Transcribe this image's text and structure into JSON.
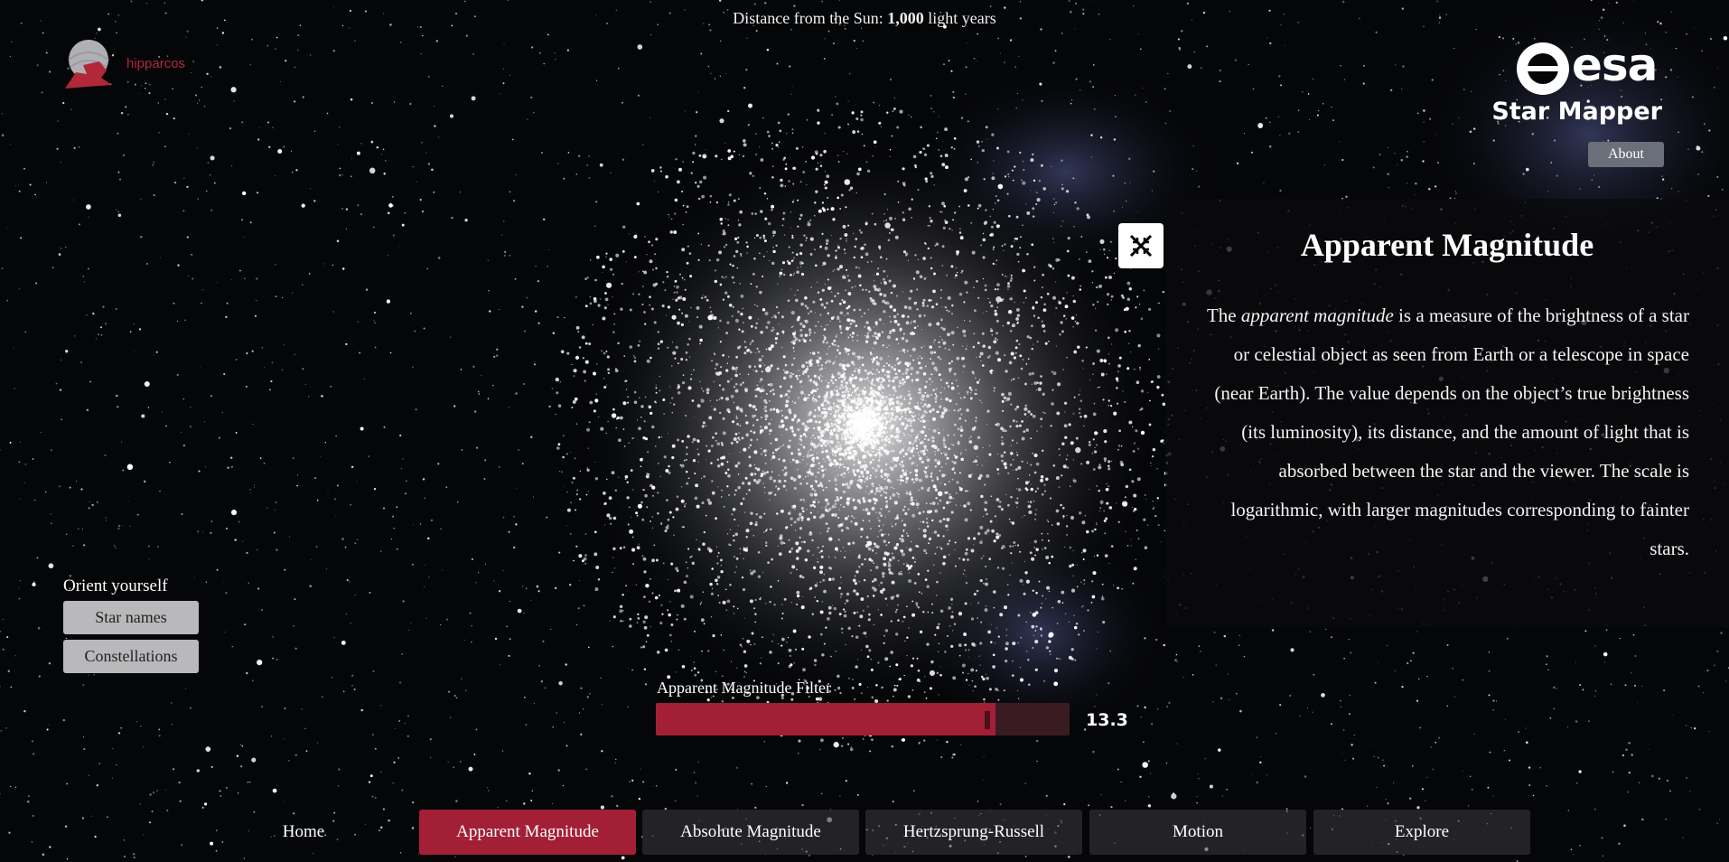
{
  "header": {
    "distance_label": "Distance from the Sun:",
    "distance_value": "1,000",
    "distance_unit": "light years"
  },
  "logos": {
    "hipparcos_text": "hipparcos",
    "esa_text": "esa",
    "app_title": "Star Mapper"
  },
  "about_button": "About",
  "info_panel": {
    "title": "Apparent Magnitude",
    "body_prefix": "The ",
    "body_emphasis": "apparent magnitude",
    "body_rest": " is a measure of the brightness of a star or celestial object as seen from Earth or a telescope in space (near Earth). The value depends on the object’s true brightness (its luminosity), its distance, and the amount of light that is absorbed between the star and the viewer. The scale is logarithmic, with larger magnitudes corresponding to fainter stars.",
    "close_icon": "close-collapse-icon"
  },
  "orient": {
    "label": "Orient yourself",
    "buttons": [
      "Star names",
      "Constellations"
    ]
  },
  "filter": {
    "label": "Apparent Magnitude Filter",
    "value": "13.3",
    "fill_fraction": 0.82
  },
  "nav": {
    "items": [
      "Home",
      "Apparent Magnitude",
      "Absolute Magnitude",
      "Hertzsprung-Russell",
      "Motion",
      "Explore"
    ],
    "active_index": 1
  },
  "colors": {
    "accent": "#a21f36",
    "background": "#050608",
    "button_grey": "#b9b9bb"
  }
}
